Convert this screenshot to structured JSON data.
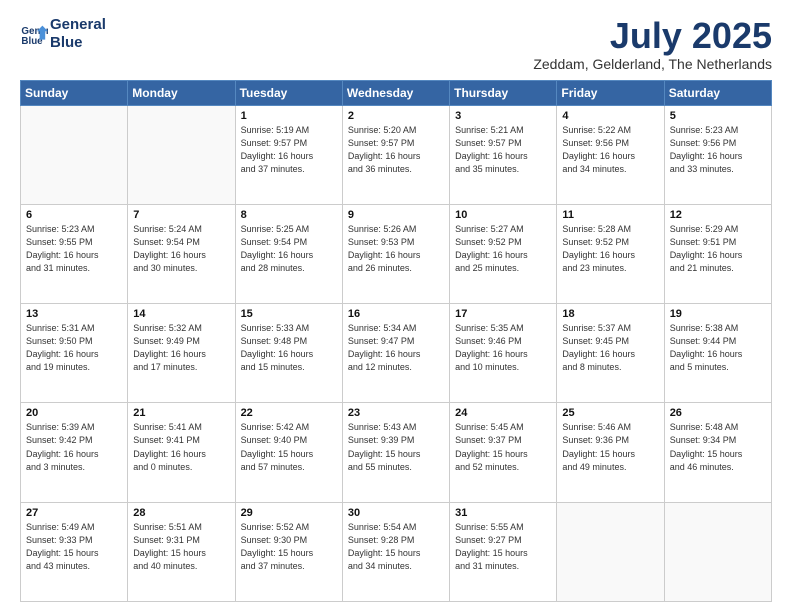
{
  "header": {
    "logo_line1": "General",
    "logo_line2": "Blue",
    "month": "July 2025",
    "location": "Zeddam, Gelderland, The Netherlands"
  },
  "days_of_week": [
    "Sunday",
    "Monday",
    "Tuesday",
    "Wednesday",
    "Thursday",
    "Friday",
    "Saturday"
  ],
  "weeks": [
    [
      {
        "day": "",
        "info": ""
      },
      {
        "day": "",
        "info": ""
      },
      {
        "day": "1",
        "info": "Sunrise: 5:19 AM\nSunset: 9:57 PM\nDaylight: 16 hours\nand 37 minutes."
      },
      {
        "day": "2",
        "info": "Sunrise: 5:20 AM\nSunset: 9:57 PM\nDaylight: 16 hours\nand 36 minutes."
      },
      {
        "day": "3",
        "info": "Sunrise: 5:21 AM\nSunset: 9:57 PM\nDaylight: 16 hours\nand 35 minutes."
      },
      {
        "day": "4",
        "info": "Sunrise: 5:22 AM\nSunset: 9:56 PM\nDaylight: 16 hours\nand 34 minutes."
      },
      {
        "day": "5",
        "info": "Sunrise: 5:23 AM\nSunset: 9:56 PM\nDaylight: 16 hours\nand 33 minutes."
      }
    ],
    [
      {
        "day": "6",
        "info": "Sunrise: 5:23 AM\nSunset: 9:55 PM\nDaylight: 16 hours\nand 31 minutes."
      },
      {
        "day": "7",
        "info": "Sunrise: 5:24 AM\nSunset: 9:54 PM\nDaylight: 16 hours\nand 30 minutes."
      },
      {
        "day": "8",
        "info": "Sunrise: 5:25 AM\nSunset: 9:54 PM\nDaylight: 16 hours\nand 28 minutes."
      },
      {
        "day": "9",
        "info": "Sunrise: 5:26 AM\nSunset: 9:53 PM\nDaylight: 16 hours\nand 26 minutes."
      },
      {
        "day": "10",
        "info": "Sunrise: 5:27 AM\nSunset: 9:52 PM\nDaylight: 16 hours\nand 25 minutes."
      },
      {
        "day": "11",
        "info": "Sunrise: 5:28 AM\nSunset: 9:52 PM\nDaylight: 16 hours\nand 23 minutes."
      },
      {
        "day": "12",
        "info": "Sunrise: 5:29 AM\nSunset: 9:51 PM\nDaylight: 16 hours\nand 21 minutes."
      }
    ],
    [
      {
        "day": "13",
        "info": "Sunrise: 5:31 AM\nSunset: 9:50 PM\nDaylight: 16 hours\nand 19 minutes."
      },
      {
        "day": "14",
        "info": "Sunrise: 5:32 AM\nSunset: 9:49 PM\nDaylight: 16 hours\nand 17 minutes."
      },
      {
        "day": "15",
        "info": "Sunrise: 5:33 AM\nSunset: 9:48 PM\nDaylight: 16 hours\nand 15 minutes."
      },
      {
        "day": "16",
        "info": "Sunrise: 5:34 AM\nSunset: 9:47 PM\nDaylight: 16 hours\nand 12 minutes."
      },
      {
        "day": "17",
        "info": "Sunrise: 5:35 AM\nSunset: 9:46 PM\nDaylight: 16 hours\nand 10 minutes."
      },
      {
        "day": "18",
        "info": "Sunrise: 5:37 AM\nSunset: 9:45 PM\nDaylight: 16 hours\nand 8 minutes."
      },
      {
        "day": "19",
        "info": "Sunrise: 5:38 AM\nSunset: 9:44 PM\nDaylight: 16 hours\nand 5 minutes."
      }
    ],
    [
      {
        "day": "20",
        "info": "Sunrise: 5:39 AM\nSunset: 9:42 PM\nDaylight: 16 hours\nand 3 minutes."
      },
      {
        "day": "21",
        "info": "Sunrise: 5:41 AM\nSunset: 9:41 PM\nDaylight: 16 hours\nand 0 minutes."
      },
      {
        "day": "22",
        "info": "Sunrise: 5:42 AM\nSunset: 9:40 PM\nDaylight: 15 hours\nand 57 minutes."
      },
      {
        "day": "23",
        "info": "Sunrise: 5:43 AM\nSunset: 9:39 PM\nDaylight: 15 hours\nand 55 minutes."
      },
      {
        "day": "24",
        "info": "Sunrise: 5:45 AM\nSunset: 9:37 PM\nDaylight: 15 hours\nand 52 minutes."
      },
      {
        "day": "25",
        "info": "Sunrise: 5:46 AM\nSunset: 9:36 PM\nDaylight: 15 hours\nand 49 minutes."
      },
      {
        "day": "26",
        "info": "Sunrise: 5:48 AM\nSunset: 9:34 PM\nDaylight: 15 hours\nand 46 minutes."
      }
    ],
    [
      {
        "day": "27",
        "info": "Sunrise: 5:49 AM\nSunset: 9:33 PM\nDaylight: 15 hours\nand 43 minutes."
      },
      {
        "day": "28",
        "info": "Sunrise: 5:51 AM\nSunset: 9:31 PM\nDaylight: 15 hours\nand 40 minutes."
      },
      {
        "day": "29",
        "info": "Sunrise: 5:52 AM\nSunset: 9:30 PM\nDaylight: 15 hours\nand 37 minutes."
      },
      {
        "day": "30",
        "info": "Sunrise: 5:54 AM\nSunset: 9:28 PM\nDaylight: 15 hours\nand 34 minutes."
      },
      {
        "day": "31",
        "info": "Sunrise: 5:55 AM\nSunset: 9:27 PM\nDaylight: 15 hours\nand 31 minutes."
      },
      {
        "day": "",
        "info": ""
      },
      {
        "day": "",
        "info": ""
      }
    ]
  ]
}
